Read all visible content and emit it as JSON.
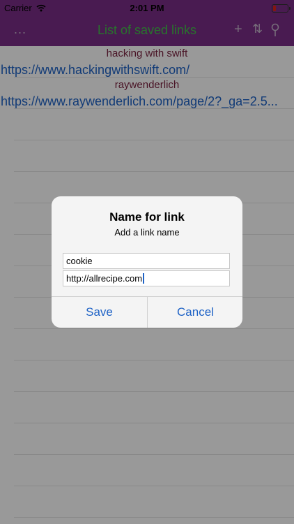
{
  "status_bar": {
    "carrier": "Carrier",
    "time": "2:01 PM",
    "wifi_icon": "wifi-icon",
    "battery_icon": "battery-low-icon",
    "battery_color": "#e0261a"
  },
  "nav": {
    "more_label": "...",
    "title": "List of saved links",
    "add_label": "+",
    "sort_label": "⇅",
    "search_icon": "search-icon",
    "bar_color": "#7a2e88",
    "title_color": "#44c24a"
  },
  "links": [
    {
      "name": "hacking with swift",
      "url": "https://www.hackingwithswift.com/"
    },
    {
      "name": "raywenderlich",
      "url": "https://www.raywenderlich.com/page/2?_ga=2.5..."
    }
  ],
  "alert": {
    "title": "Name for link",
    "message": "Add a link name",
    "name_value": "cookie",
    "url_value": "http://allrecipe.com",
    "save_label": "Save",
    "cancel_label": "Cancel"
  }
}
